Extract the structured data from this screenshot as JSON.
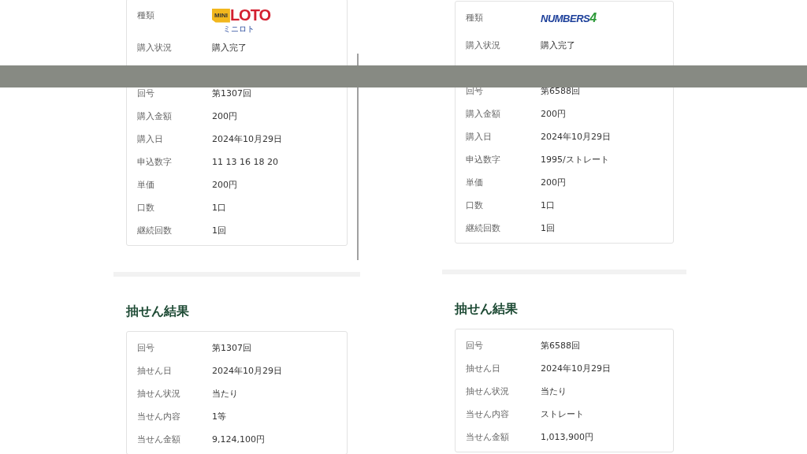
{
  "panels": [
    {
      "purchase": {
        "rows": [
          {
            "kind": "logo",
            "label": "種類",
            "logo": {
              "kind": "miniloto",
              "prefix": "MINI",
              "main": "LOTO",
              "sub": "ミニロト"
            }
          },
          {
            "kind": "text",
            "label": "購入状況",
            "value": "購入完了"
          },
          {
            "kind": "text",
            "label": "回号",
            "value": "第1307回"
          },
          {
            "kind": "text",
            "label": "購入金額",
            "value": "200円"
          },
          {
            "kind": "text",
            "label": "購入日",
            "value": "2024年10月29日"
          },
          {
            "kind": "text",
            "label": "申込数字",
            "value": "11 13 16 18 20"
          },
          {
            "kind": "text",
            "label": "単価",
            "value": "200円"
          },
          {
            "kind": "text",
            "label": "口数",
            "value": "1口"
          },
          {
            "kind": "text",
            "label": "継続回数",
            "value": "1回"
          }
        ]
      },
      "result": {
        "heading": "抽せん結果",
        "rows": [
          {
            "label": "回号",
            "value": "第1307回"
          },
          {
            "label": "抽せん日",
            "value": "2024年10月29日"
          },
          {
            "label": "抽せん状況",
            "value": "当たり"
          },
          {
            "label": "当せん内容",
            "value": "1等"
          },
          {
            "label": "当せん金額",
            "value": "9,124,100円"
          }
        ]
      }
    },
    {
      "purchase": {
        "rows": [
          {
            "kind": "logo",
            "label": "種類",
            "logo": {
              "kind": "numbers",
              "main": "NUMBERS",
              "suffix": "4"
            }
          },
          {
            "kind": "text",
            "label": "購入状況",
            "value": "購入完了"
          },
          {
            "kind": "text",
            "label": "回号",
            "value": "第6588回"
          },
          {
            "kind": "text",
            "label": "購入金額",
            "value": "200円"
          },
          {
            "kind": "text",
            "label": "購入日",
            "value": "2024年10月29日"
          },
          {
            "kind": "text",
            "label": "申込数字",
            "value": "1995/ストレート"
          },
          {
            "kind": "text",
            "label": "単価",
            "value": "200円"
          },
          {
            "kind": "text",
            "label": "口数",
            "value": "1口"
          },
          {
            "kind": "text",
            "label": "継続回数",
            "value": "1回"
          }
        ]
      },
      "result": {
        "heading": "抽せん結果",
        "rows": [
          {
            "label": "回号",
            "value": "第6588回"
          },
          {
            "label": "抽せん日",
            "value": "2024年10月29日"
          },
          {
            "label": "抽せん状況",
            "value": "当たり"
          },
          {
            "label": "当せん内容",
            "value": "ストレート"
          },
          {
            "label": "当せん金額",
            "value": "1,013,900円"
          }
        ]
      }
    }
  ]
}
